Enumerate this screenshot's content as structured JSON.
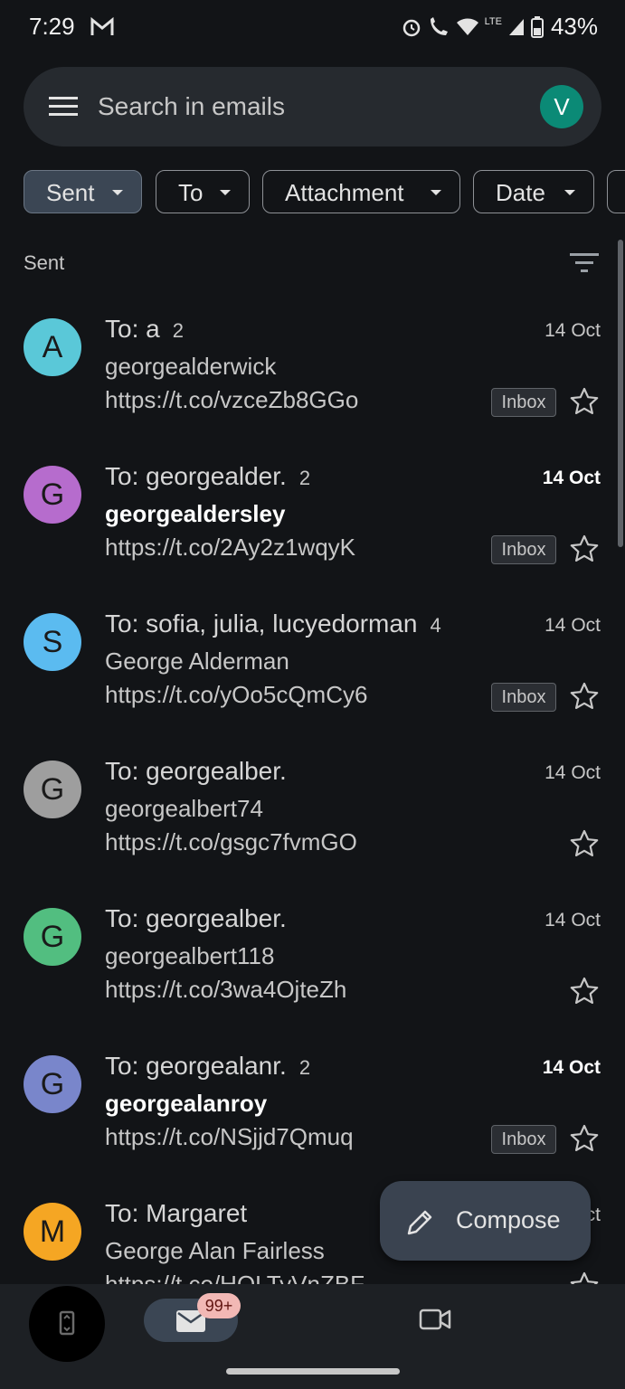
{
  "status": {
    "time": "7:29",
    "lte": "LTE",
    "battery": "43%"
  },
  "search": {
    "placeholder": "Search in emails",
    "avatar_letter": "V"
  },
  "filters": [
    "Sent",
    "To",
    "Attachment",
    "Date"
  ],
  "section_label": "Sent",
  "emails": [
    {
      "avatar": "A",
      "avatar_color": "#5ac8d8",
      "to": "To: a",
      "count": "2",
      "date": "14 Oct",
      "date_bold": false,
      "subject": "georgealderwick",
      "subject_bold": false,
      "snippet": "https://t.co/vzceZb8GGo",
      "badge": "Inbox"
    },
    {
      "avatar": "G",
      "avatar_color": "#b66ccd",
      "to": "To: georgealder.",
      "count": "2",
      "date": "14 Oct",
      "date_bold": true,
      "subject": "georgealdersley",
      "subject_bold": true,
      "snippet": "https://t.co/2Ay2z1wqyK",
      "badge": "Inbox"
    },
    {
      "avatar": "S",
      "avatar_color": "#5bbbf0",
      "to": "To: sofia, julia, lucyedorman",
      "count": "4",
      "date": "14 Oct",
      "date_bold": false,
      "subject": "George Alderman",
      "subject_bold": false,
      "snippet": "https://t.co/yOo5cQmCy6",
      "badge": "Inbox"
    },
    {
      "avatar": "G",
      "avatar_color": "#9e9e9e",
      "to": "To: georgealber.",
      "count": "",
      "date": "14 Oct",
      "date_bold": false,
      "subject": "georgealbert74",
      "subject_bold": false,
      "snippet": "https://t.co/gsgc7fvmGO",
      "badge": ""
    },
    {
      "avatar": "G",
      "avatar_color": "#52be80",
      "to": "To: georgealber.",
      "count": "",
      "date": "14 Oct",
      "date_bold": false,
      "subject": "georgealbert118",
      "subject_bold": false,
      "snippet": "https://t.co/3wa4OjteZh",
      "badge": ""
    },
    {
      "avatar": "G",
      "avatar_color": "#7986cb",
      "to": "To: georgealanr.",
      "count": "2",
      "date": "14 Oct",
      "date_bold": true,
      "subject": "georgealanroy",
      "subject_bold": true,
      "snippet": "https://t.co/NSjjd7Qmuq",
      "badge": "Inbox"
    },
    {
      "avatar": "M",
      "avatar_color": "#f5a623",
      "to": "To: Margaret",
      "count": "",
      "date": "14 Oct",
      "date_bold": false,
      "subject": "George Alan Fairless",
      "subject_bold": false,
      "snippet": "https://t.co/HQLTyVnZBF",
      "badge": ""
    }
  ],
  "compose": {
    "label": "Compose"
  },
  "nav": {
    "mail_badge": "99+"
  }
}
